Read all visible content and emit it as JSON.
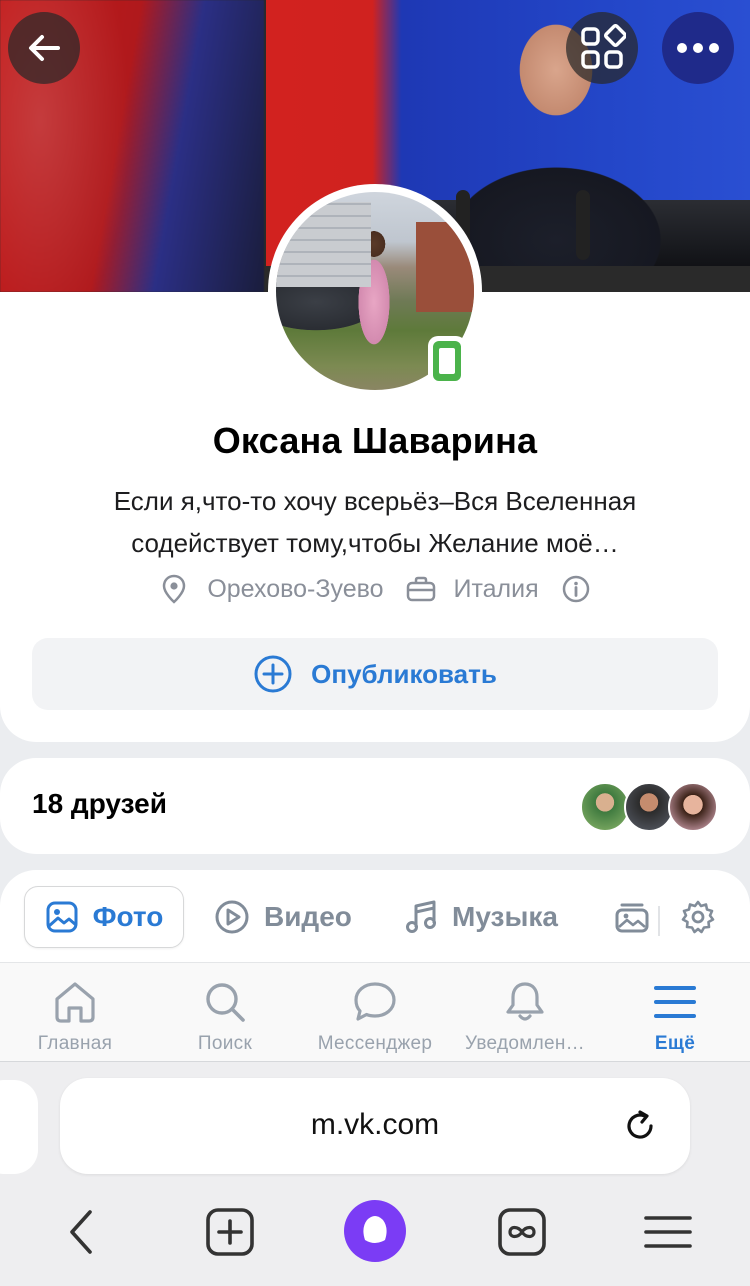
{
  "cover": {
    "back_icon": "arrow-left-icon",
    "apps_icon": "apps-grid-icon",
    "more_icon": "more-horizontal-icon"
  },
  "profile": {
    "name": "Оксана Шаварина",
    "status": "Если я,что-то хочу всерьёз–Вся Вселенная содействует тому,чтобы Желание моё…",
    "city": "Орехово-Зуево",
    "work": "Италия",
    "online_icon": "mobile-online-icon",
    "publish_label": "Опубликовать"
  },
  "friends": {
    "label": "18 друзей"
  },
  "media_tabs": {
    "photo": "Фото",
    "video": "Видео",
    "music": "Музыка"
  },
  "bottom_nav": {
    "home": "Главная",
    "search": "Поиск",
    "messenger": "Мессенджер",
    "notifications": "Уведомлен…",
    "more": "Ещё"
  },
  "browser": {
    "url": "m.vk.com"
  },
  "colors": {
    "accent": "#2a7ad4",
    "online": "#4bb34b",
    "muted": "#818c99",
    "alice": "#7b3cf5"
  }
}
